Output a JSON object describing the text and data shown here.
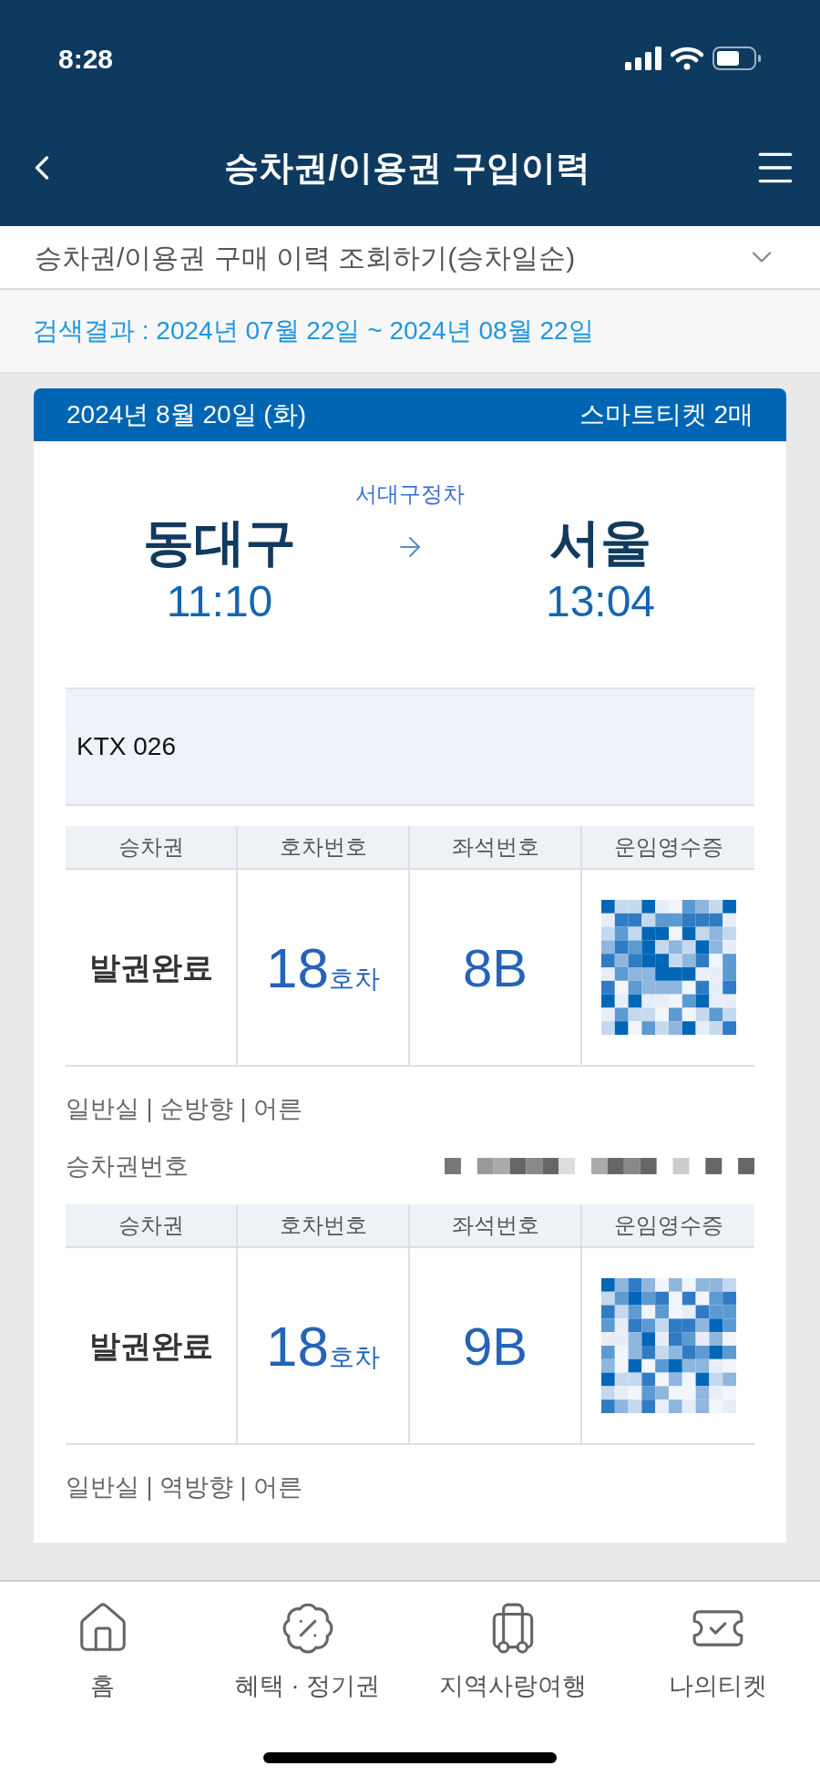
{
  "status_bar": {
    "time": "8:28"
  },
  "header": {
    "title": "승차권/이용권 구입이력"
  },
  "filter": {
    "label": "승차권/이용권 구매 이력 조회하기(승차일순)"
  },
  "search_result": "검색결과 : 2024년 07월 22일 ~ 2024년 08월 22일",
  "card": {
    "date": "2024년 8월 20일 (화)",
    "ticket_count": "스마트티켓 2매",
    "via": "서대구정차",
    "departure": {
      "station": "동대구",
      "time": "11:10"
    },
    "arrival": {
      "station": "서울",
      "time": "13:04"
    },
    "train": "KTX 026",
    "tickets": [
      {
        "columns": [
          "승차권",
          "호차번호",
          "좌석번호",
          "운임영수증"
        ],
        "status": "발권완료",
        "car_number": "18",
        "car_unit": "호차",
        "seat": "8B",
        "info": "일반실 | 순방향 | 어른",
        "number_label": "승차권번호"
      },
      {
        "columns": [
          "승차권",
          "호차번호",
          "좌석번호",
          "운임영수증"
        ],
        "status": "발권완료",
        "car_number": "18",
        "car_unit": "호차",
        "seat": "9B",
        "info": "일반실 | 역방향 | 어른"
      }
    ]
  },
  "tab_bar": [
    {
      "label": "홈"
    },
    {
      "label": "혜택 · 정기권"
    },
    {
      "label": "지역사랑여행"
    },
    {
      "label": "나의티켓"
    }
  ]
}
